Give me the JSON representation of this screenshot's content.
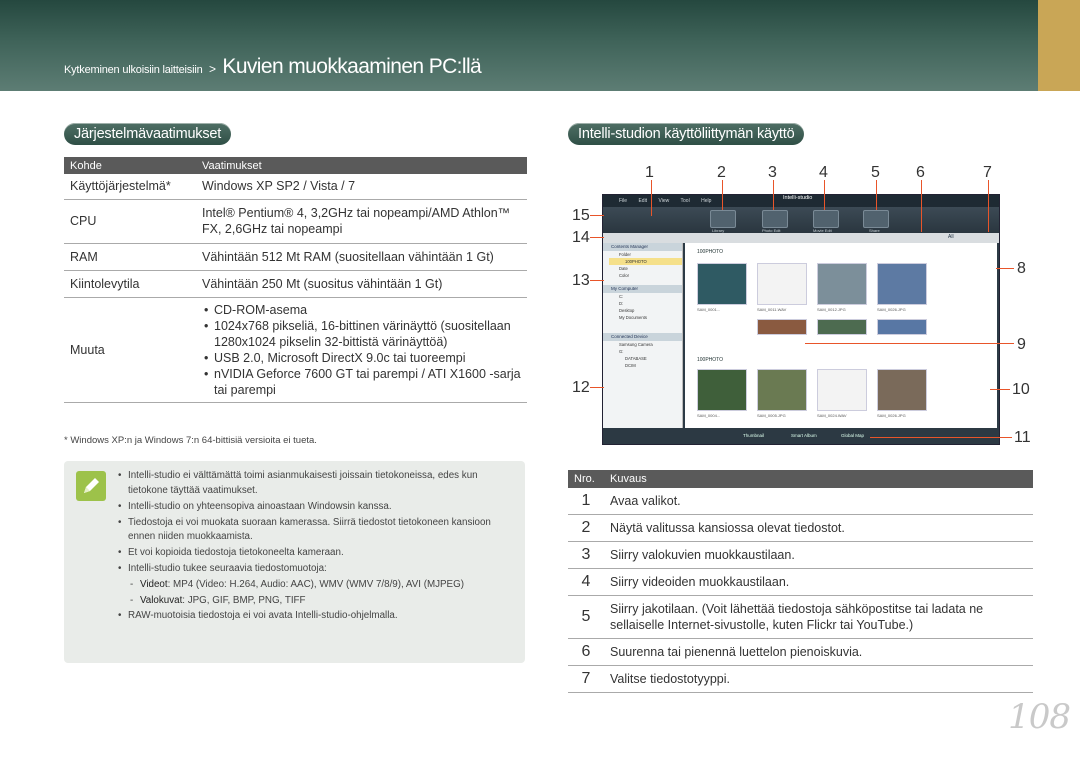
{
  "header": {
    "breadcrumb_small": "Kytkeminen ulkoisiin laitteisiin",
    "breadcrumb_sep": ">",
    "breadcrumb_title": "Kuvien muokkaaminen PC:llä",
    "accent_color": "#c9a656"
  },
  "requirements": {
    "section_title": "Järjestelmävaatimukset",
    "columns": [
      "Kohde",
      "Vaatimukset"
    ],
    "rows": [
      {
        "item": "Käyttöjärjestelmä*",
        "req": "Windows XP SP2 / Vista / 7"
      },
      {
        "item": "CPU",
        "req": "Intel® Pentium® 4, 3,2GHz tai nopeampi/AMD Athlon™ FX, 2,6GHz tai nopeampi"
      },
      {
        "item": "RAM",
        "req": "Vähintään 512 Mt RAM (suositellaan vähintään 1 Gt)"
      },
      {
        "item": "Kiintolevytila",
        "req": "Vähintään 250 Mt (suositus vähintään 1 Gt)"
      },
      {
        "item": "Muuta",
        "list": [
          "CD-ROM-asema",
          "1024x768 pikseliä, 16-bittinen värinäyttö (suositellaan 1280x1024 pikselin 32-bittistä värinäyttöä)",
          "USB 2.0, Microsoft DirectX 9.0c tai tuoreempi",
          "nVIDIA Geforce 7600 GT tai parempi / ATI X1600 -sarja tai parempi"
        ]
      }
    ],
    "footnote": "* Windows XP:n ja Windows 7:n 64-bittisiä versioita ei tueta."
  },
  "note": {
    "icon": "pencil-note-icon",
    "items": [
      "Intelli-studio ei välttämättä toimi asianmukaisesti joissain tietokoneissa, edes kun tietokone täyttää vaatimukset.",
      "Intelli-studio on yhteensopiva ainoastaan Windowsin kanssa.",
      "Tiedostoja ei voi muokata suoraan kamerassa. Siirrä tiedostot tietokoneen kansioon ennen niiden muokkaamista.",
      "Et voi kopioida tiedostoja tietokoneelta kameraan.",
      "Intelli-studio tukee seuraavia tiedostomuotoja:"
    ],
    "sub_items": [
      {
        "label": "Videot",
        "text": ": MP4 (Video: H.264, Audio: AAC), WMV (WMV 7/8/9), AVI (MJPEG)"
      },
      {
        "label": "Valokuvat",
        "text": ": JPG, GIF, BMP, PNG, TIFF"
      }
    ],
    "last_item": "RAW-muotoisia tiedostoja ei voi avata Intelli-studio-ohjelmalla."
  },
  "interface": {
    "section_title": "Intelli-studion käyttöliittymän käyttö",
    "callouts": [
      "1",
      "2",
      "3",
      "4",
      "5",
      "6",
      "7",
      "8",
      "9",
      "10",
      "11",
      "12",
      "13",
      "14",
      "15"
    ],
    "screenshot": {
      "menu": [
        "File",
        "Edit",
        "View",
        "Tool",
        "Help"
      ],
      "app_name": "Intelli-studio",
      "toolbar_labels": [
        "Library",
        "Photo Edit",
        "Movie Edit",
        "Share"
      ],
      "content_manager": "Contents Manager",
      "tree": [
        "Folder",
        "100PHOTO",
        "Date",
        "Color"
      ],
      "my_computer": "My Computer",
      "computer_tree": [
        "C:",
        "D:",
        "Desktop",
        "My Documents"
      ],
      "folder_title": "100PHOTO",
      "connected_device": "Connected Device",
      "device_tree": [
        "Samsung Camera",
        "G:",
        "DATABASE",
        "DCIM"
      ],
      "device_folder": "100PHOTO",
      "files_top": [
        "SAM_0001...",
        "SAM_0011.WAV",
        "SAM_0012.JPG",
        "SAM_0026.JPG"
      ],
      "files_bottom": [
        "SAM_0004...",
        "SAM_0005.JPG",
        "SAM_0024.WAV",
        "SAM_0026.JPG"
      ],
      "bottom_tabs": [
        "Thumbnail",
        "Smart Album",
        "Global Map"
      ],
      "view_label": "All"
    }
  },
  "descriptions": {
    "columns": [
      "Nro.",
      "Kuvaus"
    ],
    "rows": [
      {
        "n": "1",
        "text": "Avaa valikot."
      },
      {
        "n": "2",
        "text": "Näytä valitussa kansiossa olevat tiedostot."
      },
      {
        "n": "3",
        "text": "Siirry valokuvien muokkaustilaan."
      },
      {
        "n": "4",
        "text": "Siirry videoiden muokkaustilaan."
      },
      {
        "n": "5",
        "text": "Siirry jakotilaan. (Voit lähettää tiedostoja sähköpostitse tai ladata ne sellaiselle Internet-sivustolle, kuten Flickr tai YouTube.)"
      },
      {
        "n": "6",
        "text": "Suurenna tai pienennä luettelon pienoiskuvia."
      },
      {
        "n": "7",
        "text": "Valitse tiedostotyyppi."
      }
    ]
  },
  "page_number": "108"
}
